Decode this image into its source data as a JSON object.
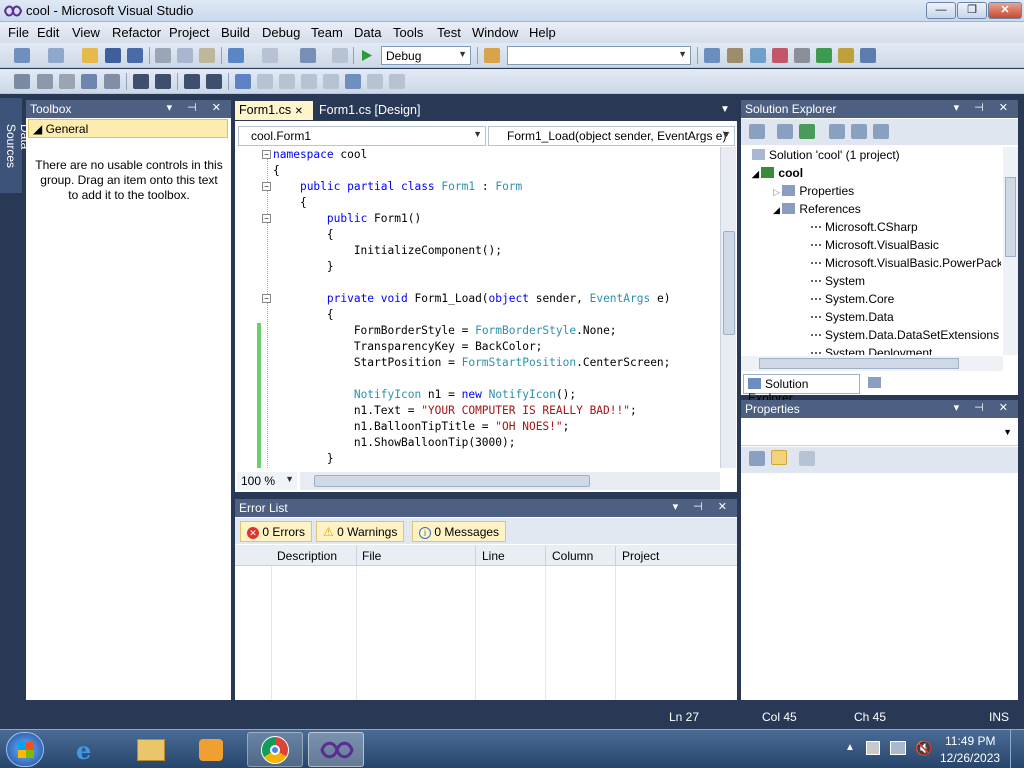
{
  "window": {
    "title": "cool - Microsoft Visual Studio",
    "btn_min": "—",
    "btn_max": "❐",
    "btn_close": "✕"
  },
  "menu": [
    "File",
    "Edit",
    "View",
    "Refactor",
    "Project",
    "Build",
    "Debug",
    "Team",
    "Data",
    "Tools",
    "Test",
    "Window",
    "Help"
  ],
  "toolbar": {
    "config": "Debug",
    "platform": ""
  },
  "side_tab": "Data Sources",
  "toolbox": {
    "title": "Toolbox",
    "group": "General",
    "empty_text": "There are no usable controls in this group. Drag an item onto this text to add it to the toolbox."
  },
  "editor": {
    "tabs": [
      "Form1.cs",
      "Form1.cs [Design]"
    ],
    "tab_close": "✕",
    "class_combo": "cool.Form1",
    "member_combo": "Form1_Load(object sender, EventArgs e)",
    "zoom": "100 %"
  },
  "error_list": {
    "title": "Error List",
    "errors": "0 Errors",
    "warnings": "0 Warnings",
    "messages": "0 Messages",
    "columns": [
      "Description",
      "File",
      "Line",
      "Column",
      "Project"
    ]
  },
  "solution_explorer": {
    "title": "Solution Explorer",
    "root": "Solution 'cool' (1 project)",
    "project": "cool",
    "properties": "Properties",
    "references": "References",
    "refs": [
      "Microsoft.CSharp",
      "Microsoft.VisualBasic",
      "Microsoft.VisualBasic.PowerPacks",
      "System",
      "System.Core",
      "System.Data",
      "System.Data.DataSetExtensions",
      "System.Deployment"
    ],
    "tab_solution": "Solution Explorer",
    "tab_team": "Team Explorer"
  },
  "properties_panel": {
    "title": "Properties"
  },
  "status": {
    "ln": "Ln 27",
    "col": "Col 45",
    "ch": "Ch 45",
    "ins": "INS"
  },
  "clock": {
    "time": "11:49 PM",
    "date": "12/26/2023"
  },
  "colors": {
    "accent": "#293955",
    "panel_header": "#4d6082",
    "keyword": "#0000ff",
    "type": "#2b91af",
    "string": "#a31515"
  }
}
